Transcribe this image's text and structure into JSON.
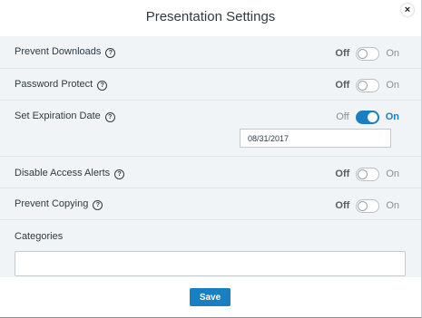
{
  "dialog": {
    "title": "Presentation Settings",
    "close_icon": "×"
  },
  "settings": [
    {
      "label": "Prevent Downloads",
      "has_help": true,
      "off_text": "Off",
      "on_text": "On",
      "state": "off"
    },
    {
      "label": "Password Protect",
      "has_help": true,
      "off_text": "Off",
      "on_text": "On",
      "state": "off"
    },
    {
      "label": "Set Expiration Date",
      "has_help": true,
      "off_text": "Off",
      "on_text": "On",
      "state": "on",
      "date_value": "08/31/2017"
    },
    {
      "label": "Disable Access Alerts",
      "has_help": true,
      "off_text": "Off",
      "on_text": "On",
      "state": "off"
    },
    {
      "label": "Prevent Copying",
      "has_help": true,
      "off_text": "Off",
      "on_text": "On",
      "state": "off"
    }
  ],
  "help_icon": "?",
  "categories": {
    "label": "Categories",
    "value": ""
  },
  "footer": {
    "save_label": "Save"
  },
  "colors": {
    "accent": "#1a7fc0",
    "panel_bg": "#f1f4f6"
  }
}
